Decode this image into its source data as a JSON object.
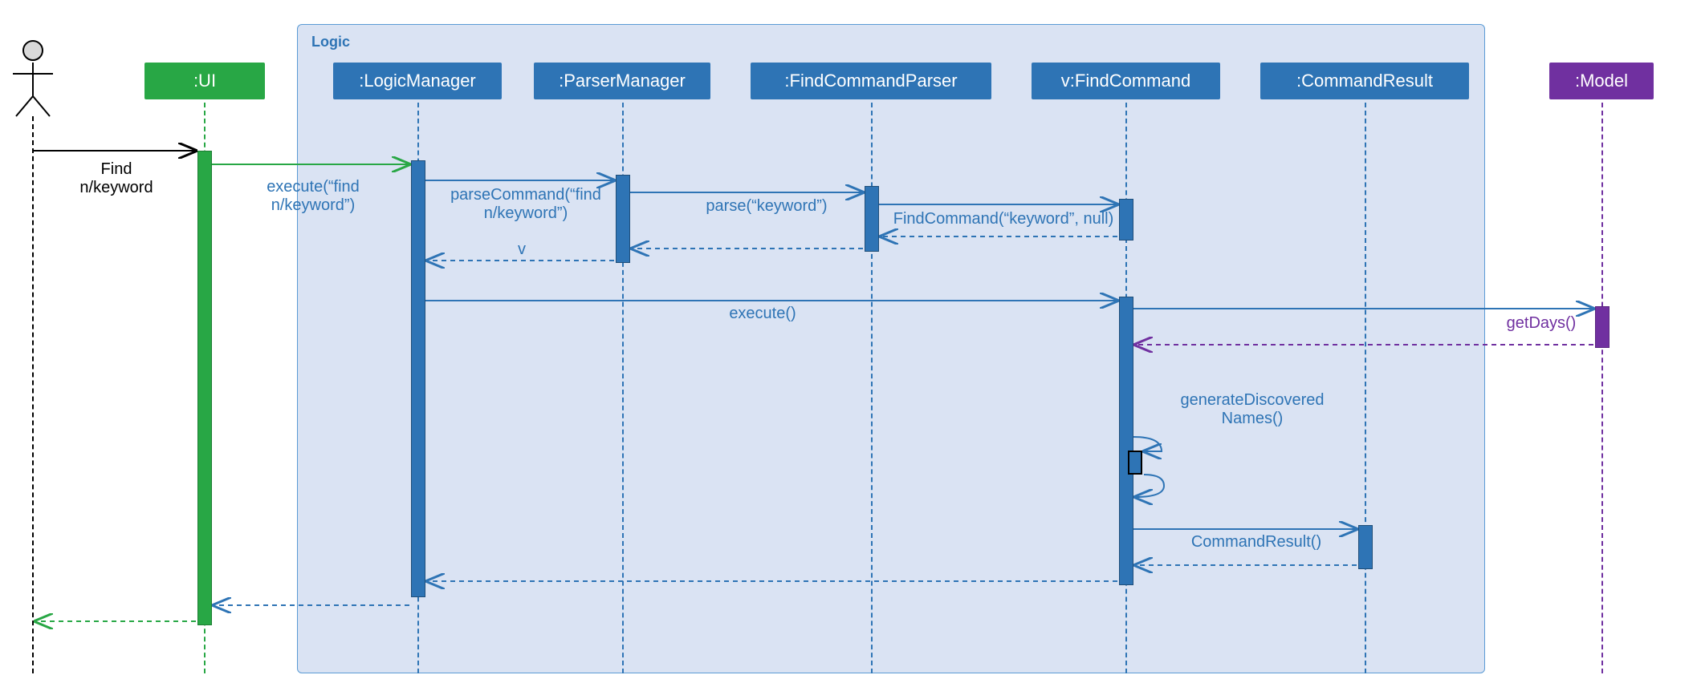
{
  "frame": {
    "label": "Logic"
  },
  "actor": {
    "input_label": "Find\nn/keyword"
  },
  "participants": {
    "ui": ":UI",
    "logicManager": ":LogicManager",
    "parserManager": ":ParserManager",
    "findCommandParser": ":FindCommandParser",
    "findCommand": "v:FindCommand",
    "commandResult": ":CommandResult",
    "model": ":Model"
  },
  "messages": {
    "execute_find": "execute(“find\nn/keyword”)",
    "parseCommand": "parseCommand(“find\nn/keyword”)",
    "parse_keyword": "parse(“keyword”)",
    "findCommand_ctor": "FindCommand(“keyword”, null)",
    "return_v": "v",
    "execute_plain": "execute()",
    "getDays": "getDays()",
    "generateNames": "generateDiscovered\nNames()",
    "commandResult_ctor": "CommandResult()"
  }
}
